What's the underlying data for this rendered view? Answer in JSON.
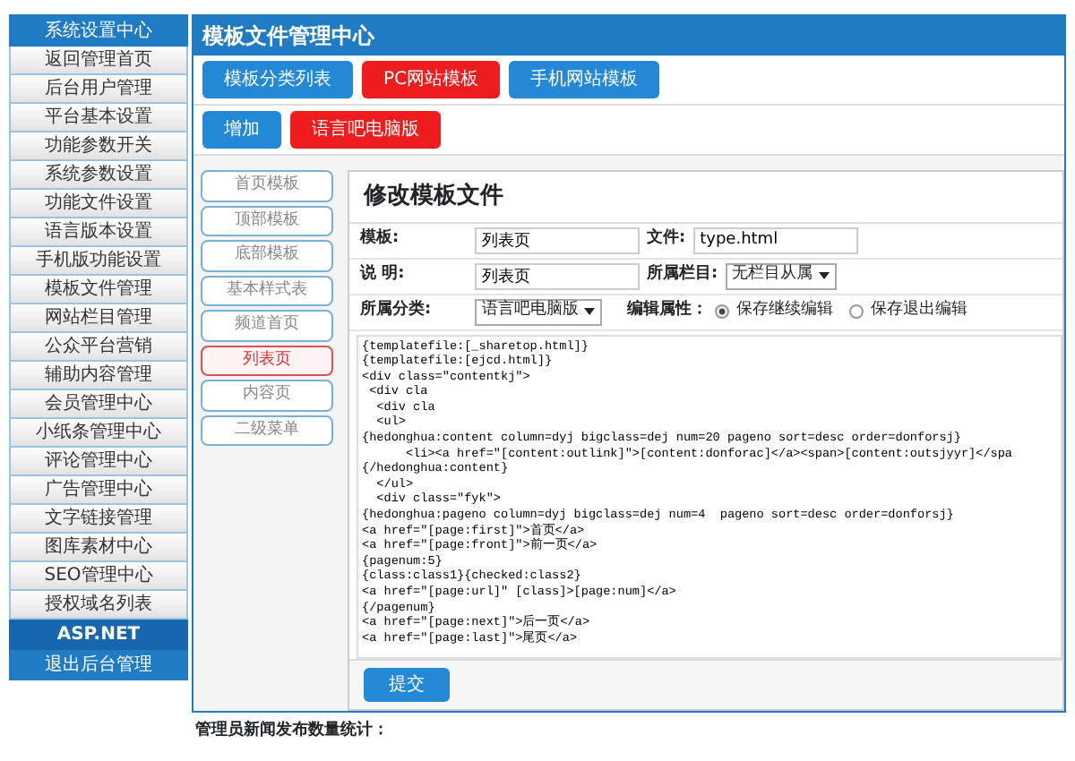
{
  "sidebar": {
    "title": "系统设置中心",
    "items": [
      "返回管理首页",
      "后台用户管理",
      "平台基本设置",
      "功能参数开关",
      "系统参数设置",
      "功能文件设置",
      "语言版本设置",
      "手机版功能设置",
      "模板文件管理",
      "网站栏目管理",
      "公众平台营销",
      "辅助内容管理",
      "会员管理中心",
      "小纸条管理中心",
      "评论管理中心",
      "广告管理中心",
      "文字链接管理",
      "图库素材中心",
      "SEO管理中心",
      "授权域名列表"
    ],
    "footer_title": "ASP.NET",
    "footer_link": "退出后台管理"
  },
  "header": {
    "title": "模板文件管理中心"
  },
  "tabs": [
    {
      "label": "模板分类列表",
      "selected": false
    },
    {
      "label": "PC网站模板",
      "selected": true
    },
    {
      "label": "手机网站模板",
      "selected": false
    }
  ],
  "actions": [
    {
      "label": "增加",
      "selected": false
    },
    {
      "label": "语言吧电脑版",
      "selected": true
    }
  ],
  "template_list": [
    {
      "label": "首页模板",
      "selected": false
    },
    {
      "label": "顶部模板",
      "selected": false
    },
    {
      "label": "底部模板",
      "selected": false
    },
    {
      "label": "基本样式表",
      "selected": false
    },
    {
      "label": "频道首页",
      "selected": false
    },
    {
      "label": "列表页",
      "selected": true
    },
    {
      "label": "内容页",
      "selected": false
    },
    {
      "label": "二级菜单",
      "selected": false
    }
  ],
  "form": {
    "heading": "修改模板文件",
    "template_label": "模板:",
    "template_value": "列表页",
    "file_label": "文件:",
    "file_value": "type.html",
    "desc_label": "说 明:",
    "desc_value": "列表页",
    "column_label": "所属栏目:",
    "column_value": "无栏目从属",
    "category_label": "所属分类:",
    "category_value": "语言吧电脑版",
    "edit_label": "编辑属性：",
    "edit_options": [
      {
        "label": "保存继续编辑",
        "selected": true
      },
      {
        "label": "保存退出编辑",
        "selected": false
      }
    ],
    "code_lines": [
      "{templatefile:[_sharetop.html]}",
      "{templatefile:[ejcd.html]}",
      "<div class=\"contentkj\">",
      " <div cla",
      "  <div cla",
      "  <ul>",
      "{hedonghua:content column=dyj bigclass=dej num=20 pageno sort=desc order=donforsj}",
      "      <li><a href=\"[content:outlink]\">[content:donforac]</a><span>[content:outsjyyr]</spa",
      "{/hedonghua:content}",
      "  </ul>",
      "  <div class=\"fyk\">",
      "{hedonghua:pageno column=dyj bigclass=dej num=4  pageno sort=desc order=donforsj}",
      "<a href=\"[page:first]\">首页</a>",
      "<a href=\"[page:front]\">前一页</a>",
      "{pagenum:5}",
      "{class:class1}{checked:class2}",
      "<a href=\"[page:url]\" [class]>[page:num]</a>",
      "{/pagenum}",
      "<a href=\"[page:next]\">后一页</a>",
      "<a href=\"[page:last]\">尾页</a>"
    ],
    "submit": "提交"
  },
  "status_bar": "管理员新闻发布数量统计："
}
